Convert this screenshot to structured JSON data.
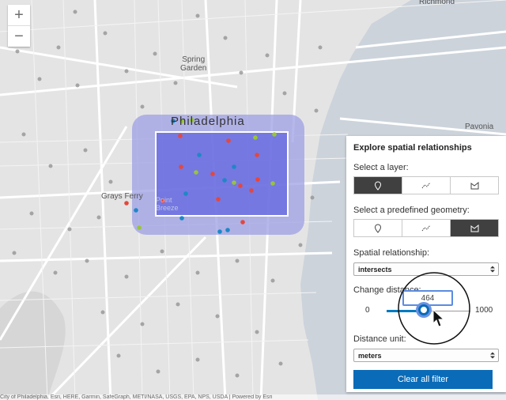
{
  "map": {
    "labels": {
      "richmond": "Richmond",
      "spring_garden": "Spring\nGarden",
      "philadelphia": "Philadelphia",
      "grays_ferry": "Grays Ferry",
      "point_breeze": "Point\nBreeze",
      "pavonia": "Pavonia"
    },
    "zoom_in": "+",
    "zoom_out": "−",
    "attribution": "City of Philadelphia, Esri, HERE, Garmin, SafeGraph, METI/NASA, USGS, EPA, NPS, USDA | Powered by Esri",
    "colors": {
      "geometry_fill": "#6b6fe0",
      "buffer_fill": "#9ea0e6",
      "red": "#e5473d",
      "blue": "#1f87c7",
      "green": "#98c43b"
    }
  },
  "panel": {
    "title": "Explore spatial relationships",
    "layer_label": "Select a layer:",
    "layer_options": [
      "point-icon",
      "polyline-icon",
      "polygon-icon"
    ],
    "layer_selected": 0,
    "geometry_label": "Select a predefined geometry:",
    "geometry_options": [
      "point-icon",
      "polyline-icon",
      "polygon-icon"
    ],
    "geometry_selected": 2,
    "relationship_label": "Spatial relationship:",
    "relationship_value": "intersects",
    "distance_label": "Change distance:",
    "distance_value": "464",
    "distance_min": "0",
    "distance_max": "1000",
    "unit_label": "Distance unit:",
    "unit_value": "meters",
    "clear_button": "Clear all filter"
  }
}
